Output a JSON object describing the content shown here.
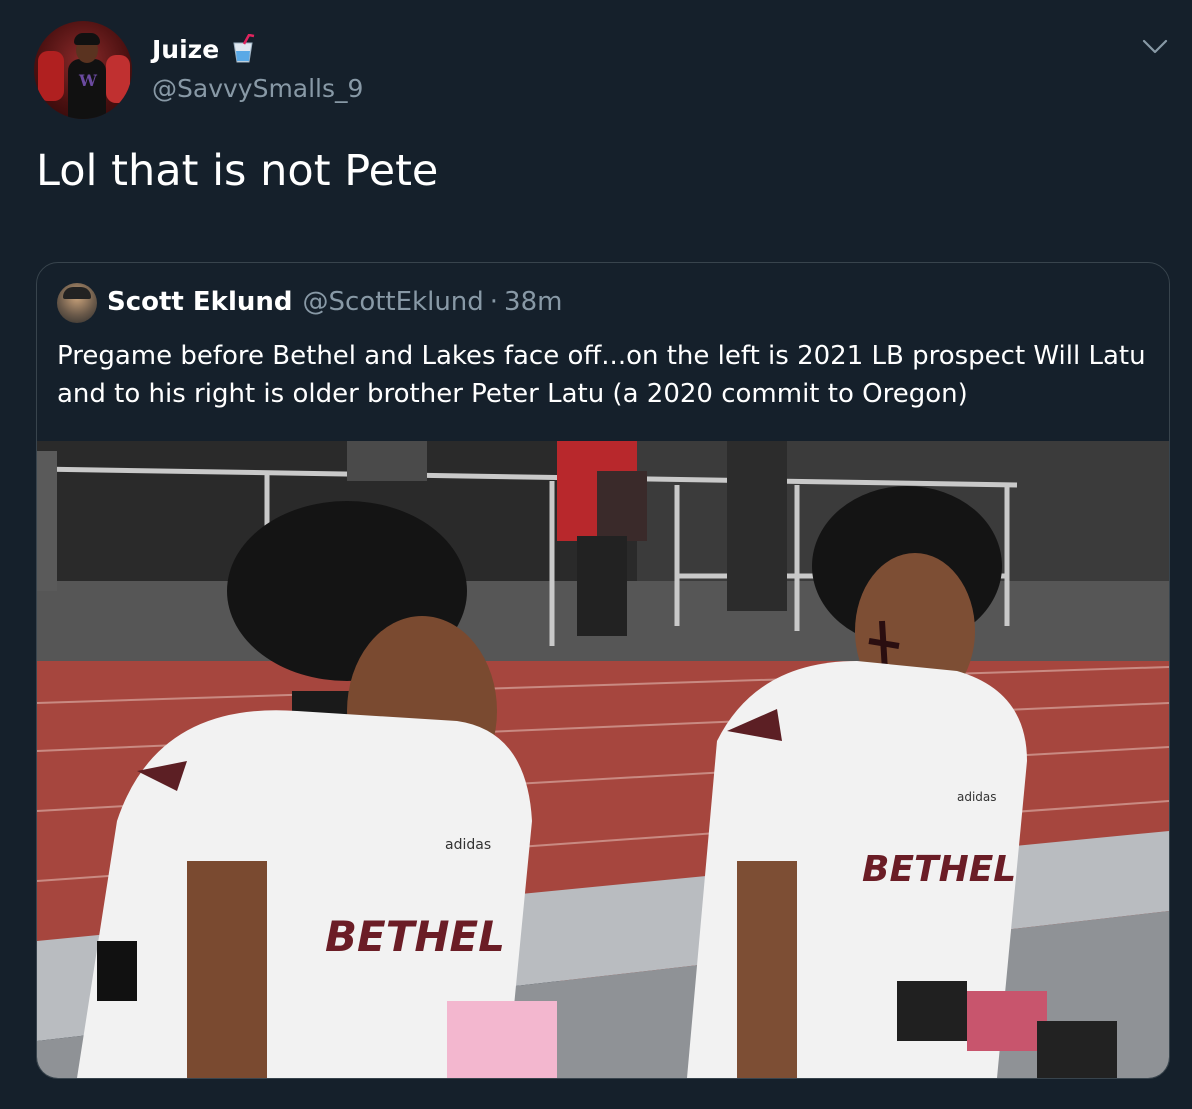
{
  "author": {
    "display_name": "Juize",
    "emoji_icon": "cup-with-straw-icon",
    "handle": "@SavvySmalls_9"
  },
  "tweet": {
    "text": "Lol that is not Pete"
  },
  "quoted_tweet": {
    "display_name": "Scott Eklund",
    "handle": "@ScottEklund",
    "separator": "·",
    "time": "38m",
    "text": "Pregame before Bethel and Lakes face off...on the left is 2021 LB prospect Will Latu and to his right is older brother Peter Latu (a 2020 commit to Oregon)",
    "photo": {
      "jersey_text_left": "BETHEL",
      "jersey_text_right": "BETHEL",
      "brand_text": "adidas"
    }
  },
  "colors": {
    "background": "#15202b",
    "border": "#38444d",
    "secondary_text": "#8899a6",
    "primary_text": "#ffffff"
  },
  "icons": {
    "menu": "chevron-down-icon"
  }
}
